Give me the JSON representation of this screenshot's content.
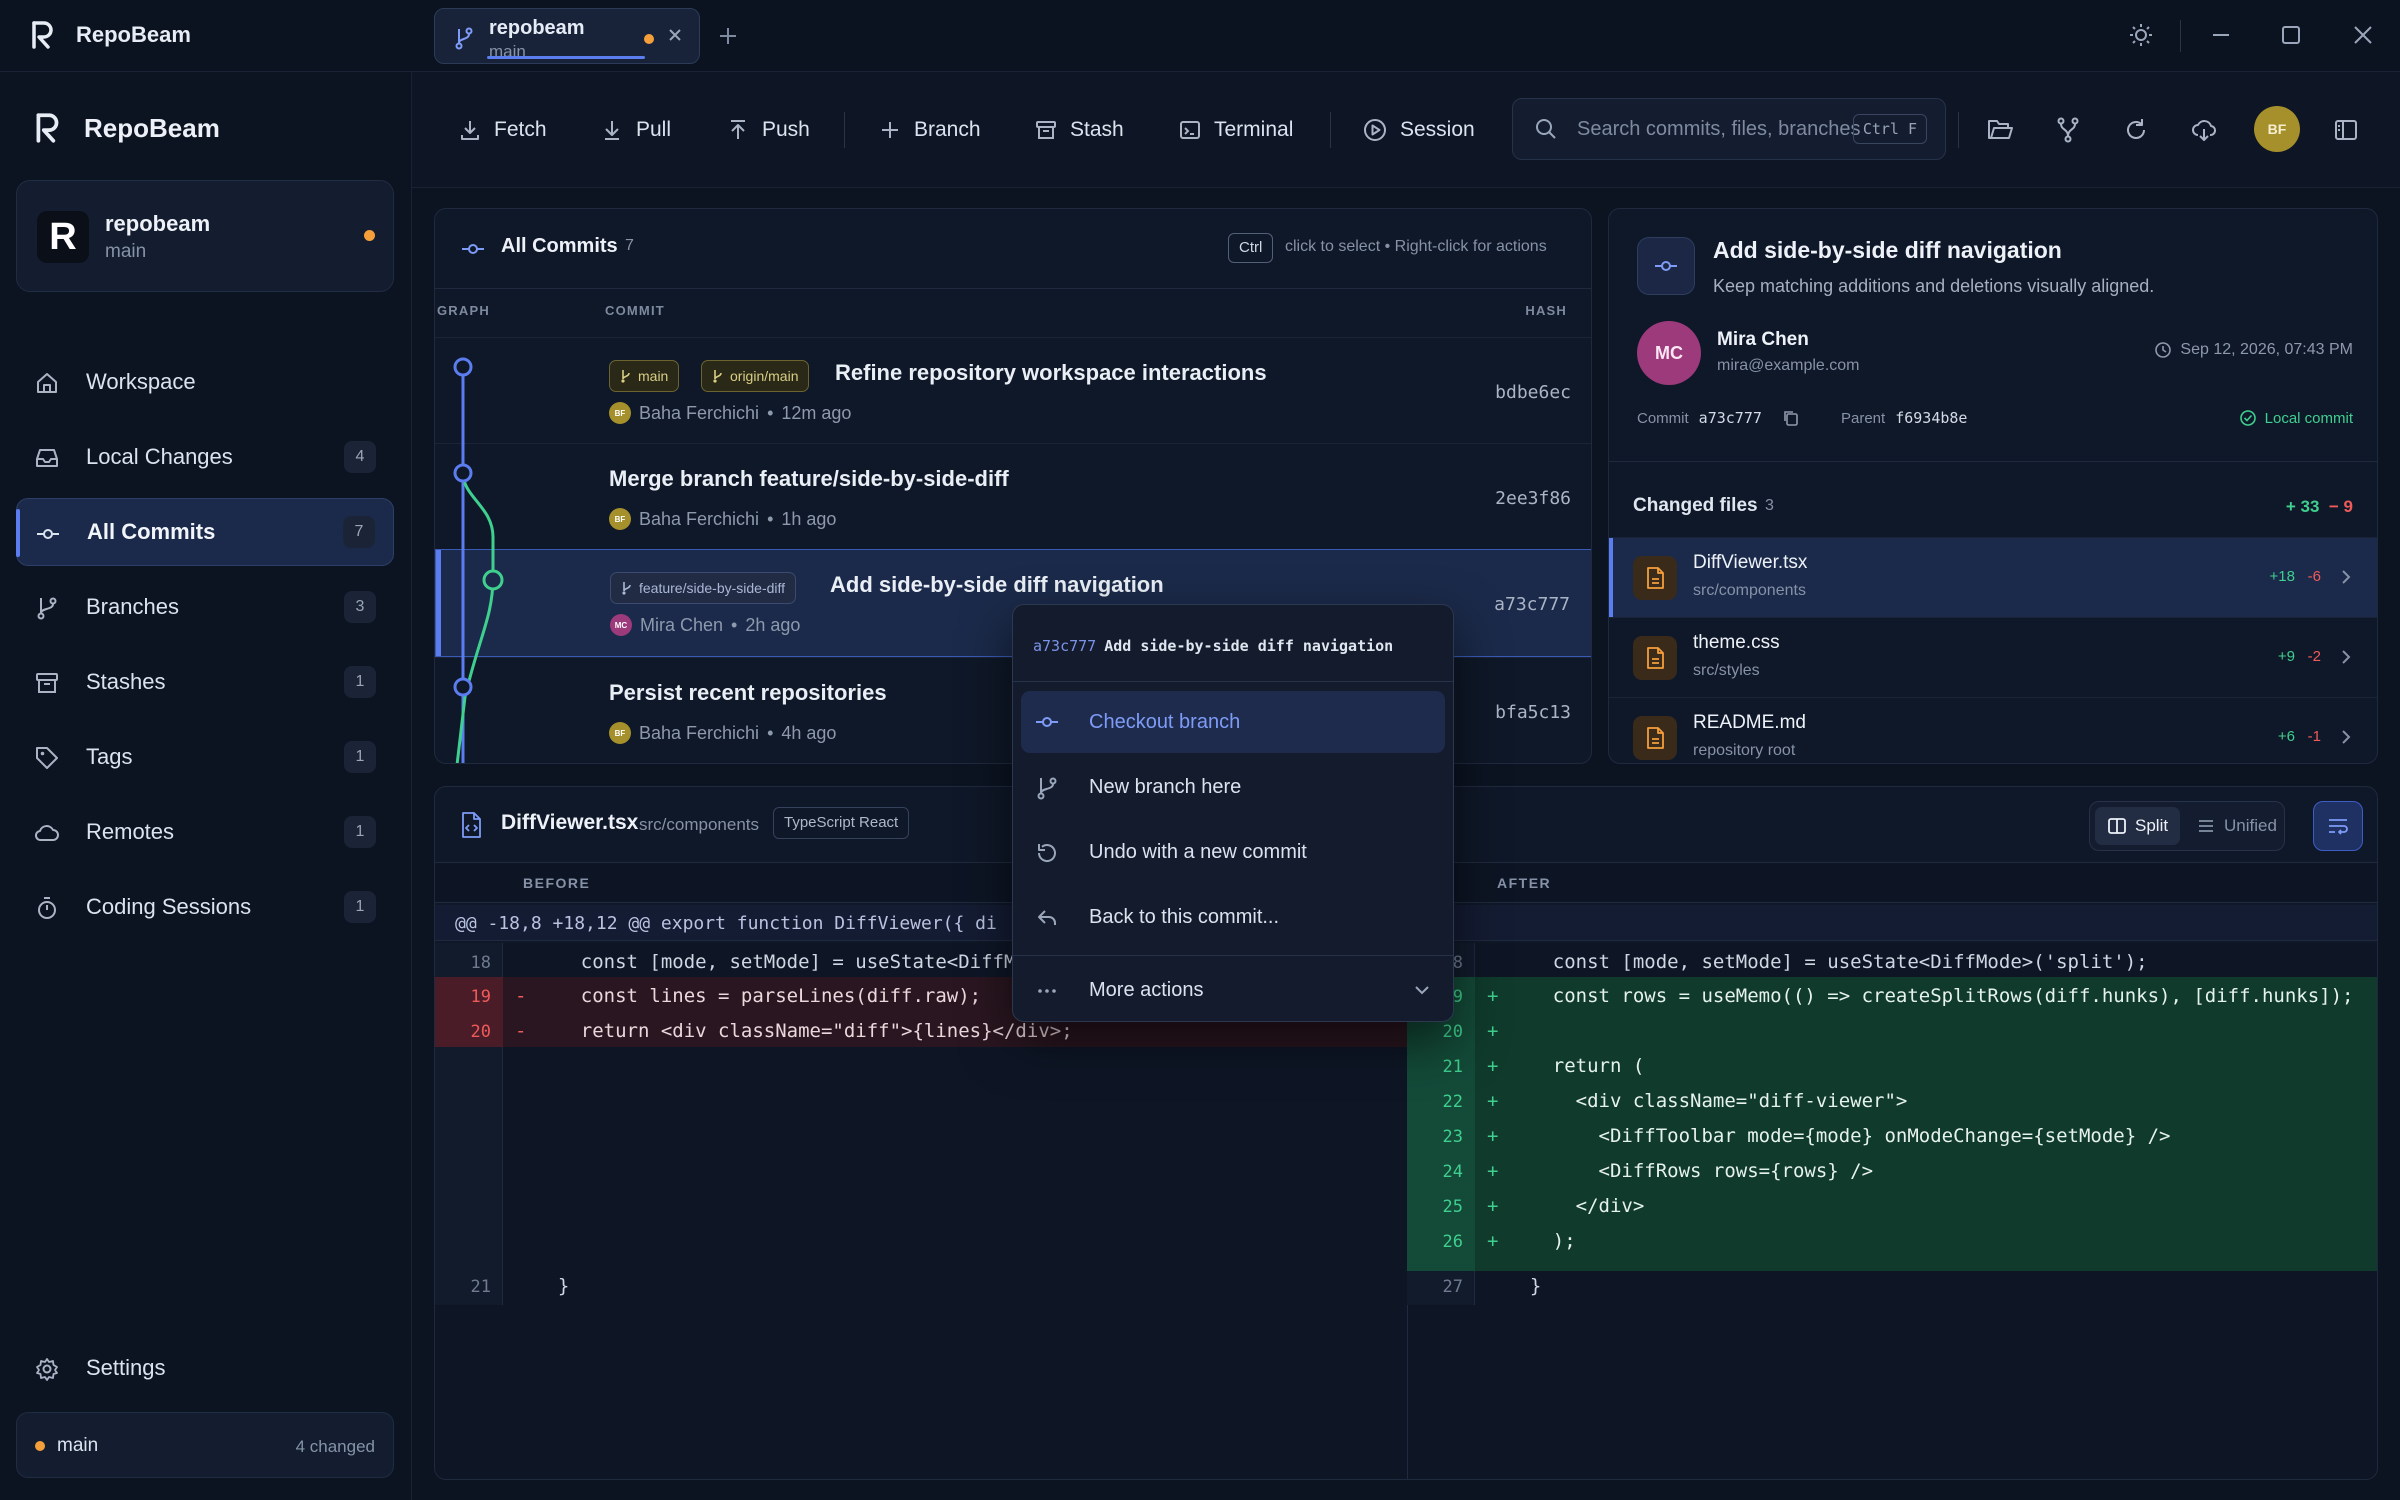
{
  "app": {
    "name": "RepoBeam"
  },
  "tab": {
    "repo": "repobeam",
    "branch": "main"
  },
  "sidebar": {
    "brand": "RepoBeam",
    "repo": {
      "name": "repobeam",
      "branch": "main",
      "avatar": "R"
    },
    "items": [
      {
        "label": "Workspace",
        "icon": "home-icon",
        "count": ""
      },
      {
        "label": "Local Changes",
        "icon": "inbox-icon",
        "count": "4"
      },
      {
        "label": "All Commits",
        "icon": "commit-icon",
        "count": "7",
        "active": true
      },
      {
        "label": "Branches",
        "icon": "branch-icon",
        "count": "3"
      },
      {
        "label": "Stashes",
        "icon": "archive-icon",
        "count": "1"
      },
      {
        "label": "Tags",
        "icon": "tag-icon",
        "count": "1"
      },
      {
        "label": "Remotes",
        "icon": "cloud-icon",
        "count": "1"
      },
      {
        "label": "Coding Sessions",
        "icon": "timer-icon",
        "count": "1"
      }
    ],
    "settings": "Settings",
    "status": {
      "branch": "main",
      "changed": "4 changed"
    }
  },
  "toolbar": {
    "fetch": "Fetch",
    "pull": "Pull",
    "push": "Push",
    "branch": "Branch",
    "stash": "Stash",
    "terminal": "Terminal",
    "session": "Session",
    "search_placeholder": "Search commits, files, branches",
    "search_shortcut": "Ctrl F",
    "user_initials": "BF"
  },
  "commits": {
    "title": "All Commits",
    "count": "7",
    "kbd": "Ctrl",
    "hint1": "click to select",
    "hint2": "Right-click for actions",
    "col_graph": "GRAPH",
    "col_commit": "COMMIT",
    "col_hash": "HASH",
    "rows": [
      {
        "refs": [
          "main",
          "origin/main"
        ],
        "message": "Refine repository workspace interactions",
        "author": "Baha Ferchichi",
        "initials": "BF",
        "time": "12m ago",
        "hash": "bdbe6ec"
      },
      {
        "refs": [],
        "message": "Merge branch feature/side-by-side-diff",
        "author": "Baha Ferchichi",
        "initials": "BF",
        "time": "1h ago",
        "hash": "2ee3f86"
      },
      {
        "refs": [
          "feature/side-by-side-diff"
        ],
        "message": "Add side-by-side diff navigation",
        "author": "Mira Chen",
        "initials": "MC",
        "time": "2h ago",
        "hash": "a73c777"
      },
      {
        "refs": [],
        "message": "Persist recent repositories",
        "author": "Baha Ferchichi",
        "initials": "BF",
        "time": "4h ago",
        "hash": "bfa5c13"
      }
    ]
  },
  "details": {
    "title": "Add side-by-side diff navigation",
    "subtitle": "Keep matching additions and deletions visually aligned.",
    "author": {
      "name": "Mira Chen",
      "email": "mira@example.com",
      "initials": "MC"
    },
    "date": "Sep 12, 2026, 07:43 PM",
    "commit_label": "Commit",
    "commit": "a73c777",
    "parent_label": "Parent",
    "parent": "f6934b8e",
    "local": "Local commit",
    "changed_title": "Changed files",
    "changed_count": "3",
    "total_add": "+ 33",
    "total_del": "− 9",
    "files": [
      {
        "name": "DiffViewer.tsx",
        "path": "src/components",
        "add": "+18",
        "del": "-6"
      },
      {
        "name": "theme.css",
        "path": "src/styles",
        "add": "+9",
        "del": "-2"
      },
      {
        "name": "README.md",
        "path": "repository root",
        "add": "+6",
        "del": "-1"
      }
    ]
  },
  "diff": {
    "file": "DiffViewer.tsx",
    "path": "src/components",
    "lang": "TypeScript React",
    "split": "Split",
    "unified": "Unified",
    "before_label": "BEFORE",
    "after_label": "AFTER",
    "hunk": "@@ -18,8 +18,12 @@ export function DiffViewer({ di",
    "before": [
      {
        "n": "18",
        "t": " ",
        "code": "    const [mode, setMode] = useState<DiffMo"
      },
      {
        "n": "19",
        "t": "-",
        "code": "    const lines = parseLines(diff.raw);"
      },
      {
        "n": "20",
        "t": "-",
        "code": "    return <div className=\"diff\">{lines}</div>;"
      },
      {
        "n": "21",
        "t": " ",
        "code": "  }"
      }
    ],
    "after": [
      {
        "n": "8",
        "t": " ",
        "code": "    const [mode, setMode] = useState<DiffMode>('split');"
      },
      {
        "n": "9",
        "t": "+",
        "code": "    const rows = useMemo(() => createSplitRows(diff.hunks), [diff.hunks]);"
      },
      {
        "n": "20",
        "t": "+",
        "code": ""
      },
      {
        "n": "21",
        "t": "+",
        "code": "    return ("
      },
      {
        "n": "22",
        "t": "+",
        "code": "      <div className=\"diff-viewer\">"
      },
      {
        "n": "23",
        "t": "+",
        "code": "        <DiffToolbar mode={mode} onModeChange={setMode} />"
      },
      {
        "n": "24",
        "t": "+",
        "code": "        <DiffRows rows={rows} />"
      },
      {
        "n": "25",
        "t": "+",
        "code": "      </div>"
      },
      {
        "n": "26",
        "t": "+",
        "code": "    );"
      },
      {
        "n": "27",
        "t": " ",
        "code": "  }"
      }
    ]
  },
  "context_menu": {
    "hash": "a73c777",
    "message": "Add side-by-side diff navigation",
    "items": [
      "Checkout branch",
      "New branch here",
      "Undo with a new commit",
      "Back to this commit...",
      "More actions"
    ]
  },
  "colors": {
    "accent": "#5b7df0",
    "add": "#3fcf8e",
    "del": "#ef5a5a",
    "warn": "#f59f3a"
  }
}
